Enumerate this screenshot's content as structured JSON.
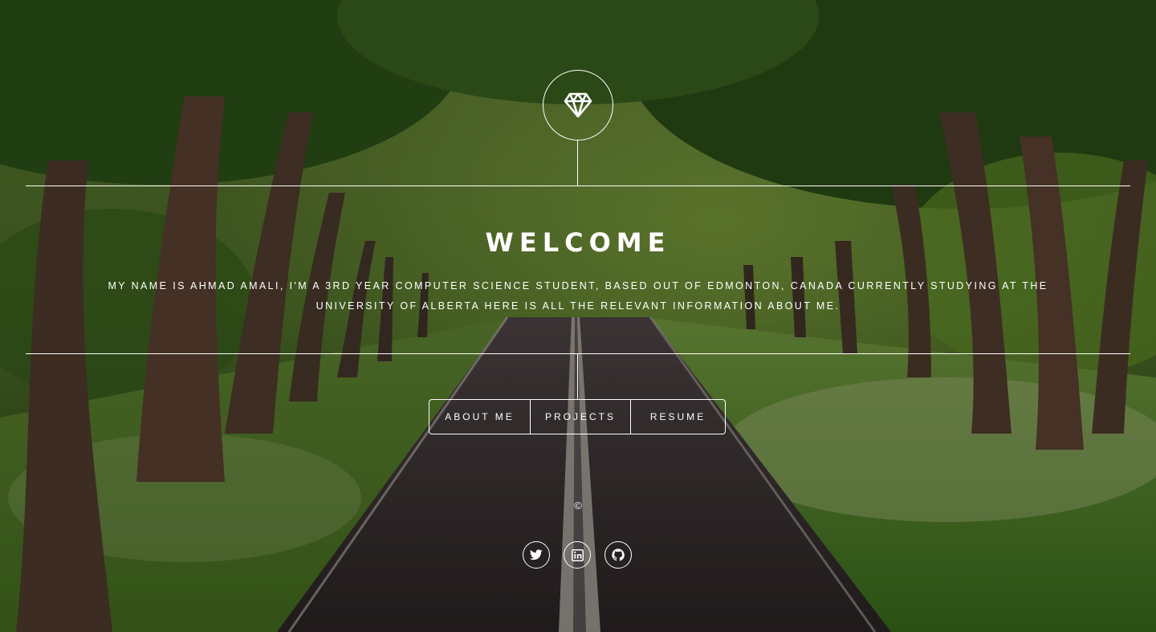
{
  "header": {
    "logo_icon": "diamond-icon"
  },
  "main": {
    "title": "WELCOME",
    "intro": "MY NAME IS AHMAD AMALI, I'M A 3RD YEAR COMPUTER SCIENCE STUDENT, BASED OUT OF EDMONTON, CANADA CURRENTLY STUDYING AT THE UNIVERSITY OF ALBERTA HERE IS ALL THE RELEVANT INFORMATION ABOUT ME."
  },
  "nav": {
    "items": [
      {
        "label": "ABOUT ME"
      },
      {
        "label": "PROJECTS"
      },
      {
        "label": "RESUME"
      }
    ]
  },
  "footer": {
    "copyright": "©",
    "social": [
      {
        "icon": "twitter-icon"
      },
      {
        "icon": "linkedin-icon"
      },
      {
        "icon": "github-icon"
      }
    ]
  },
  "colors": {
    "text": "#ffffff",
    "foliage": "#3f6b21",
    "road": "#3d2f36"
  }
}
